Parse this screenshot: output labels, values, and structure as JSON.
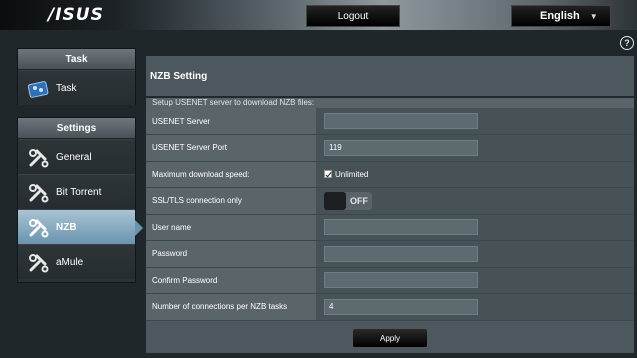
{
  "header": {
    "logo_text": "/ISUS",
    "logout_label": "Logout",
    "language": "English"
  },
  "sidebar": {
    "task_header": "Task",
    "task_item": "Task",
    "settings_header": "Settings",
    "items": [
      {
        "label": "General",
        "icon": "wrench-icon"
      },
      {
        "label": "Bit Torrent",
        "icon": "wrench-icon"
      },
      {
        "label": "NZB",
        "icon": "wrench-icon",
        "active": true
      },
      {
        "label": "aMule",
        "icon": "wrench-icon"
      }
    ]
  },
  "main": {
    "title": "NZB Setting",
    "section_desc": "Setup USENET server to download NZB files:",
    "fields": {
      "usenet_server": {
        "label": "USENET Server",
        "value": ""
      },
      "usenet_port": {
        "label": "USENET Server Port",
        "value": "119"
      },
      "max_speed": {
        "label": "Maximum download speed:",
        "checkbox_label": "Unlimited",
        "checked": true
      },
      "ssl_only": {
        "label": "SSL/TLS connection only",
        "toggle_state": "OFF"
      },
      "username": {
        "label": "User name",
        "value": ""
      },
      "password": {
        "label": "Password",
        "value": ""
      },
      "confirm_password": {
        "label": "Confirm Password",
        "value": ""
      },
      "connections": {
        "label": "Number of connections per NZB tasks",
        "value": "4"
      }
    },
    "apply_label": "Apply"
  },
  "colors": {
    "accent_active": "#6a94ad",
    "panel_header": "#5b656b",
    "form_label_bg": "#596569",
    "form_value_bg": "#465256"
  }
}
